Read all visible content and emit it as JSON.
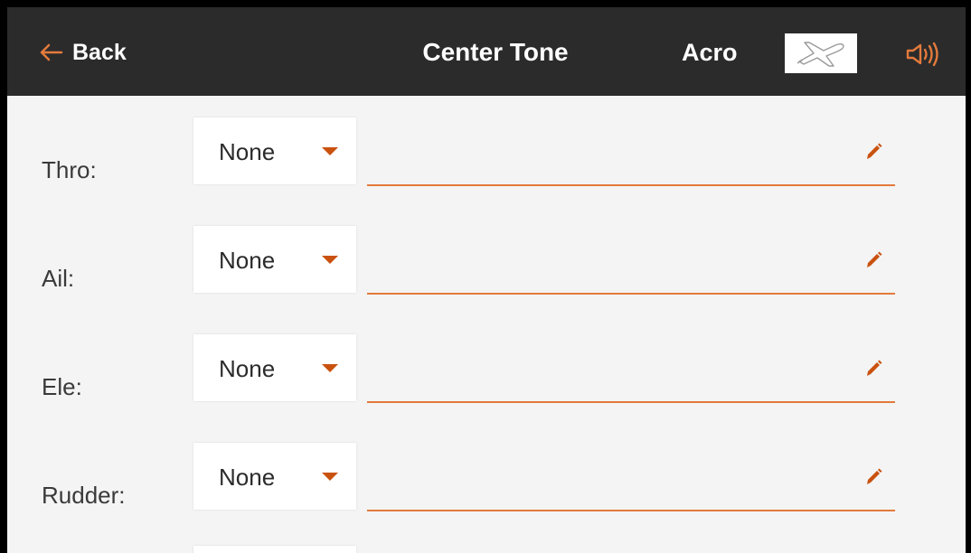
{
  "header": {
    "back_label": "Back",
    "title": "Center Tone",
    "mode": "Acro",
    "model_icon": "airplane-icon",
    "sound_icon": "speaker-icon"
  },
  "rows": [
    {
      "label": "Thro:",
      "value": "None",
      "name": ""
    },
    {
      "label": "Ail:",
      "value": "None",
      "name": ""
    },
    {
      "label": "Ele:",
      "value": "None",
      "name": ""
    },
    {
      "label": "Rudder:",
      "value": "None",
      "name": ""
    }
  ],
  "colors": {
    "header_bg": "#2b2b2b",
    "accent": "#e37a3c",
    "accent_dark": "#c9520f",
    "background": "#f4f4f4"
  }
}
